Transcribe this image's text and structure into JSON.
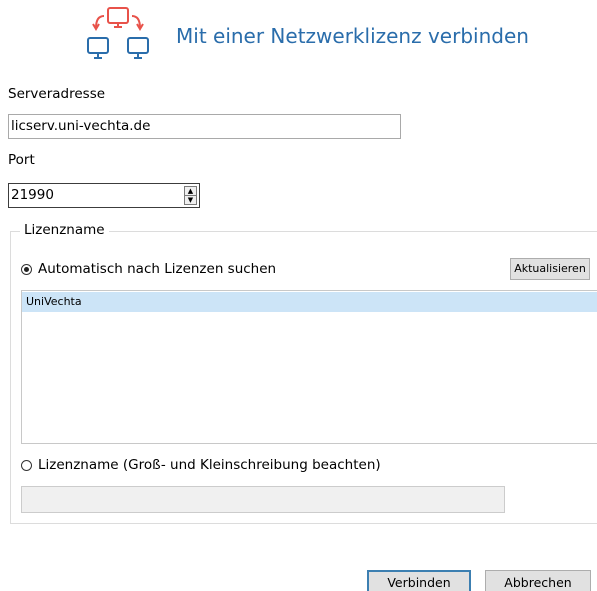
{
  "header": {
    "title": "Mit einer Netzwerklizenz verbinden",
    "icon": "network-computers-icon",
    "icon_colors": {
      "top": "#e8524a",
      "bottom": "#2a6dab"
    }
  },
  "server": {
    "label": "Serveradresse",
    "value": "licserv.uni-vechta.de"
  },
  "port": {
    "label": "Port",
    "value": "21990"
  },
  "license_group": {
    "legend": "Lizenzname",
    "auto_search": {
      "label": "Automatisch nach Lizenzen suchen",
      "checked": true
    },
    "refresh_button": "Aktualisieren",
    "licenses": [
      "UniVechta"
    ],
    "selected_license": "UniVechta",
    "manual_name": {
      "label": "Lizenzname (Groß- und Kleinschreibung beachten)",
      "checked": false,
      "value": ""
    }
  },
  "buttons": {
    "connect": "Verbinden",
    "cancel": "Abbrechen"
  },
  "colors": {
    "accent": "#2a6dab",
    "selection": "#cce4f7",
    "default_button_border": "#3c7fb1"
  }
}
